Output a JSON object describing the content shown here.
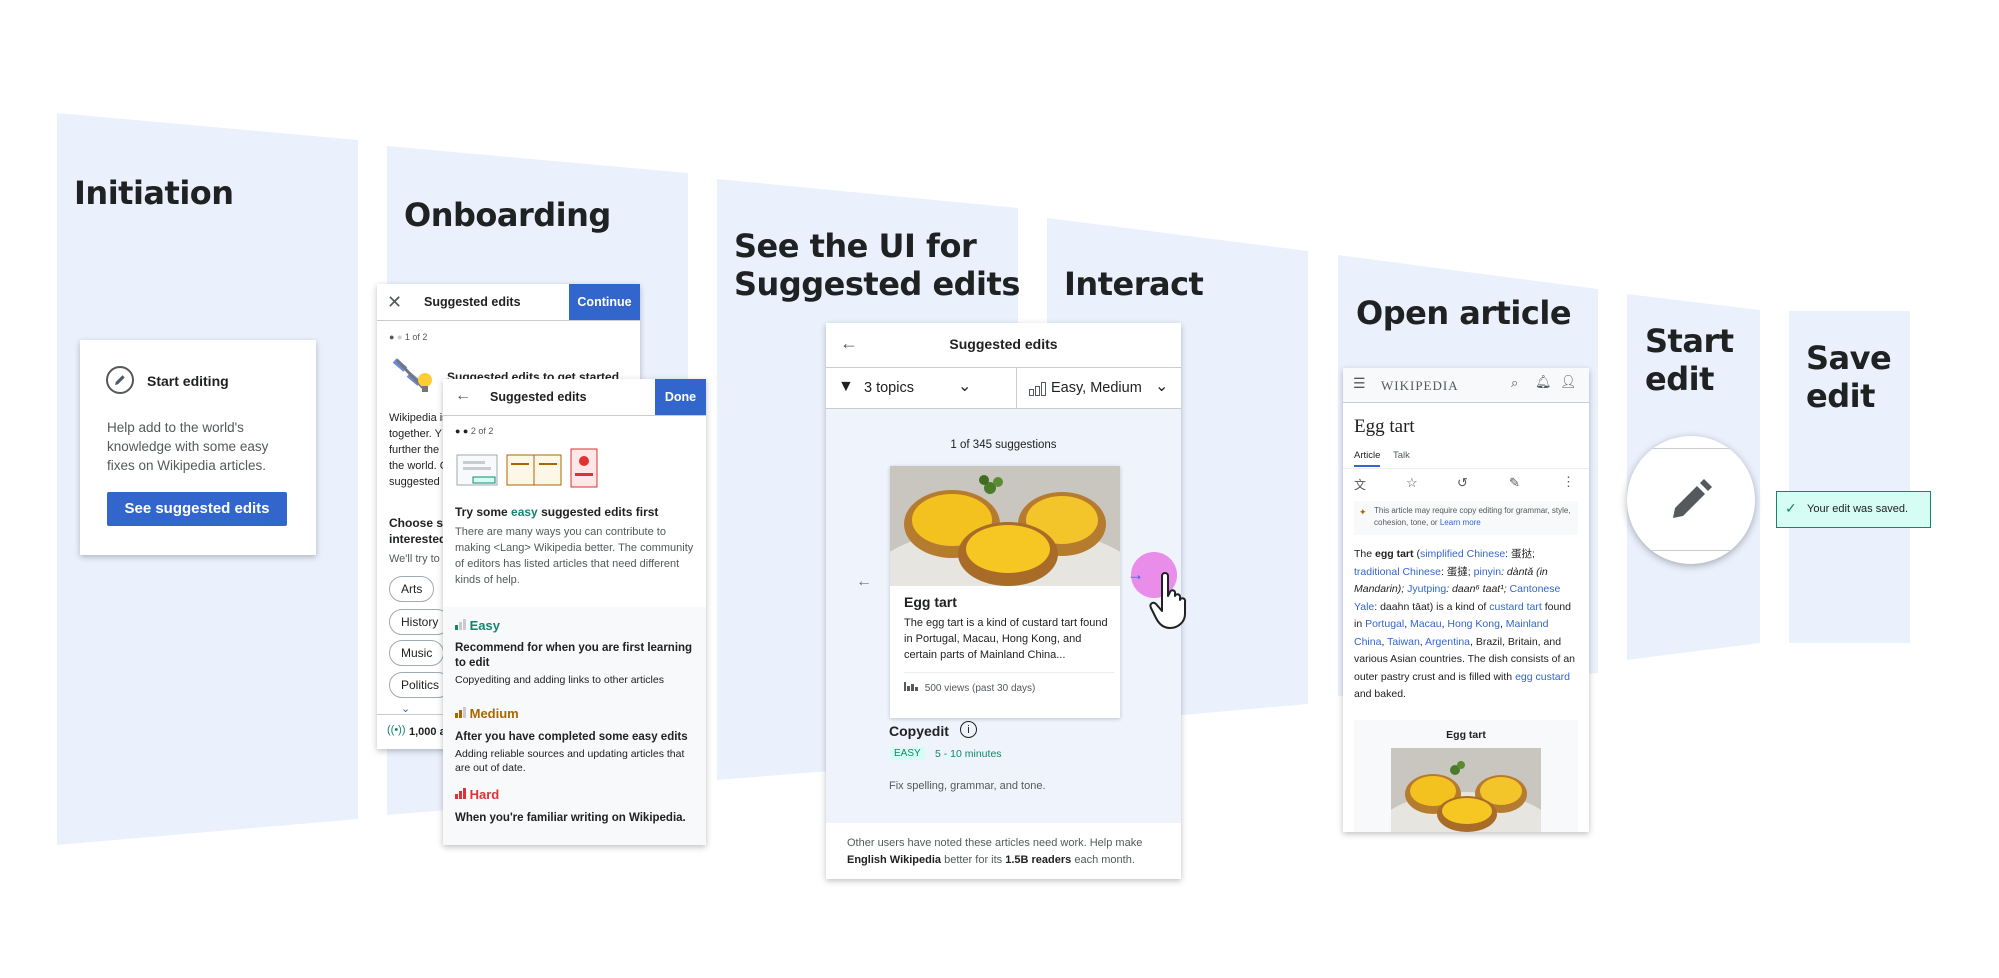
{
  "stages": {
    "initiation": "Initiation",
    "onboarding": "Onboarding",
    "see_ui_line1": "See the UI for",
    "see_ui_line2": "Suggested edits",
    "interact": "Interact",
    "open_article": "Open article",
    "start_edit_line1": "Start",
    "start_edit_line2": "edit",
    "save_edit_line1": "Save",
    "save_edit_line2": "edit"
  },
  "start_card": {
    "title": "Start editing",
    "body": "Help add to the world's knowledge with some easy fixes on Wikipedia articles.",
    "button": "See suggested edits"
  },
  "onboard1": {
    "title": "Suggested edits",
    "continue": "Continue",
    "step": "1 of 2",
    "heading": "Suggested edits to get started",
    "text_lines": [
      "Wikipedia is",
      "together. Y",
      "further the r",
      "the world. C",
      "suggested e"
    ],
    "choose_line1": "Choose so",
    "choose_line2": "interested",
    "choose_sub": "We'll try to",
    "topics": [
      "Arts",
      "History",
      "Music",
      "Politics"
    ],
    "footer": "1,000 a"
  },
  "onboard2": {
    "title": "Suggested edits",
    "done": "Done",
    "step": "2 of 2",
    "heading_pre": "Try some ",
    "heading_em": "easy",
    "heading_post": " suggested edits first",
    "body": "There are many ways you can contribute to making <Lang> Wikipedia better. The community of editors has listed articles that need different kinds of help.",
    "levels": [
      {
        "label": "Easy",
        "color": "#14866d",
        "title": "Recommend for when you are first learning to edit",
        "desc": "Copyediting and adding links to other articles"
      },
      {
        "label": "Medium",
        "color": "#ac6600",
        "title": "After you have completed some easy edits",
        "desc": "Adding reliable sources and updating articles that are out of date."
      },
      {
        "label": "Hard",
        "color": "#d33",
        "title": "When you're familiar writing on Wikipedia.",
        "desc": ""
      }
    ]
  },
  "suggested_ui": {
    "title": "Suggested edits",
    "topics_filter": "3 topics",
    "difficulty_filter": "Easy, Medium",
    "count": "1 of 345 suggestions",
    "article_title": "Egg tart",
    "article_extract": "The egg tart is a kind of custard tart found in Portugal, Macau, Hong Kong, and certain parts of Mainland China...",
    "views": "500 views (past 30 days)",
    "task_type": "Copyedit",
    "badge": "EASY",
    "duration": "5 - 10 minutes",
    "task_desc": "Fix spelling, grammar, and tone.",
    "footer_pre": "Other users have noted these articles need work. Help make ",
    "footer_bold1": "English Wikipedia",
    "footer_mid": " better for its ",
    "footer_bold2": "1.5B readers",
    "footer_post": " each month."
  },
  "article": {
    "logo": "WIKIPEDIA",
    "title": "Egg tart",
    "tab_article": "Article",
    "tab_talk": "Talk",
    "notice": "This article may require copy editing for grammar, style, cohesion, tone, or",
    "learn_more": "Learn more",
    "p_the": "The ",
    "p_egg": "egg tart",
    "p_open": " (",
    "p_simplified": "simplified Chinese",
    "p_s1": ": 蛋挞; ",
    "p_traditional": "traditional Chinese",
    "p_s2": ": 蛋撻; ",
    "p_pinyin": "pinyin",
    "p_s3": ": dàntǎ (in Mandarin); ",
    "p_jyutping": "Jyutping",
    "p_s4": ": daan⁶ taat¹; ",
    "p_cantonese": "Cantonese Yale",
    "p_s5": ": daahn tāat) is a kind of ",
    "p_custard": "custard tart",
    "p_s6": " found in ",
    "p_portugal": "Portugal",
    "p_c1": ", ",
    "p_macau": "Macau",
    "p_c2": ", ",
    "p_hk": "Hong Kong",
    "p_c3": ", ",
    "p_mainland": "Mainland China",
    "p_c4": ", ",
    "p_taiwan": "Taiwan",
    "p_c5": ", ",
    "p_argentina": "Argentina",
    "p_s7": ", Brazil, Britain, and various Asian countries. The dish consists of an outer pastry crust and is filled with ",
    "p_eggcustard": "egg custard",
    "p_s8": " and baked.",
    "infobox_title": "Egg tart"
  },
  "save": {
    "toast": "Your edit was saved."
  },
  "colors": {
    "panel": "#eaf1fd",
    "accent_blue": "#3366cc",
    "easy_green": "#14866d",
    "medium_orange": "#ac6600",
    "hard_red": "#d33",
    "pointer_pink": "#e879e6"
  },
  "icons": [
    "pencil-icon",
    "close-icon",
    "back-arrow-icon",
    "filter-icon",
    "bar-chart-icon",
    "chevron-down-icon",
    "forward-arrow-icon",
    "info-icon",
    "menu-icon",
    "search-icon",
    "bell-icon",
    "user-icon",
    "translate-icon",
    "star-icon",
    "history-icon",
    "more-icon",
    "check-icon",
    "hand-cursor-icon"
  ]
}
